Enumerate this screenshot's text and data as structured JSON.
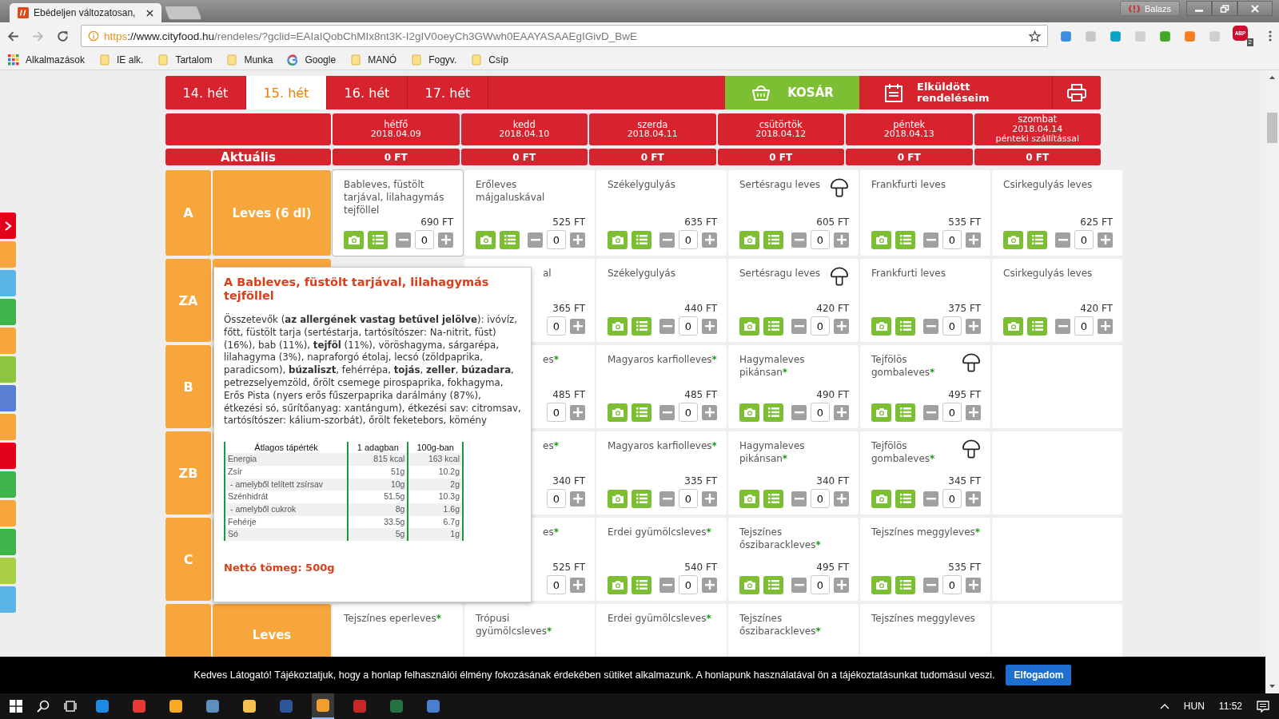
{
  "browser": {
    "tab_title": "Ebédeljen változatosan,",
    "profile": "Balazs",
    "url": {
      "scheme": "https",
      "authority": "://www.cityfood.hu",
      "path": "/rendeles/?gclid=EAIaIQobChMIx8nt3K-I2gIV0oeyCh3GWwh0EAAYASAAEgIGivD_BwE"
    },
    "adblock_label": "ABP",
    "adblock_badge": "2",
    "bookmarks": [
      {
        "label": "Alkalmazások",
        "kind": "apps"
      },
      {
        "label": "IE alk.",
        "kind": "folder"
      },
      {
        "label": "Tartalom",
        "kind": "folder"
      },
      {
        "label": "Munka",
        "kind": "folder"
      },
      {
        "label": "Google",
        "kind": "google"
      },
      {
        "label": "MANÓ",
        "kind": "folder"
      },
      {
        "label": "Fogyv.",
        "kind": "folder"
      },
      {
        "label": "Csíp",
        "kind": "folder"
      }
    ]
  },
  "side_tabs": [
    {
      "color": "#f7a63c"
    },
    {
      "color": "#5ab4e5"
    },
    {
      "color": "#3db54a"
    },
    {
      "color": "#f7a63c"
    },
    {
      "color": "#8cc63f"
    },
    {
      "color": "#5b7fd0"
    },
    {
      "color": "#f7a63c"
    },
    {
      "color": "#e3001b"
    },
    {
      "color": "#3db54a"
    },
    {
      "color": "#f7a63c"
    },
    {
      "color": "#3db54a"
    },
    {
      "color": "#a8cf45"
    },
    {
      "color": "#5ab4e5"
    }
  ],
  "weeks": [
    {
      "label": "14. hét",
      "selected": false
    },
    {
      "label": "15. hét",
      "selected": true
    },
    {
      "label": "16. hét",
      "selected": false
    },
    {
      "label": "17. hét",
      "selected": false
    }
  ],
  "cart": "KOSÁR",
  "sent_orders": "Elküldött rendeléseim",
  "days": [
    {
      "name": "hétfő",
      "date": "2018.04.09"
    },
    {
      "name": "kedd",
      "date": "2018.04.10"
    },
    {
      "name": "szerda",
      "date": "2018.04.11"
    },
    {
      "name": "csütörtök",
      "date": "2018.04.12"
    },
    {
      "name": "péntek",
      "date": "2018.04.13"
    },
    {
      "name": "szombat",
      "date": "2018.04.14",
      "note": "pénteki szállítással"
    }
  ],
  "current": {
    "label": "Aktuális",
    "totals": [
      "0 FT",
      "0 FT",
      "0 FT",
      "0 FT",
      "0 FT",
      "0 FT"
    ]
  },
  "rows": [
    {
      "code": "A",
      "category": "Leves (6 dl)",
      "cells": [
        {
          "kind": "dish",
          "name": "Bableves, füstölt tarjával, lilahagymás tejföllel",
          "mushroom": false,
          "price": "690 FT",
          "quantity": "0"
        },
        {
          "kind": "dish",
          "name": "Erőleves májgaluskával",
          "mushroom": false,
          "price": "525 FT",
          "quantity": "0"
        },
        {
          "kind": "dish",
          "name": "Székelygulyás",
          "mushroom": false,
          "price": "635 FT",
          "quantity": "0"
        },
        {
          "kind": "dish",
          "name": "Sertésragu leves",
          "mushroom": true,
          "price": "605 FT",
          "quantity": "0"
        },
        {
          "kind": "dish",
          "name": "Frankfurti leves",
          "mushroom": false,
          "price": "535 FT",
          "quantity": "0"
        },
        {
          "kind": "dish",
          "name": "Csirkegulyás leves",
          "mushroom": false,
          "price": "625 FT",
          "quantity": "0"
        }
      ]
    },
    {
      "code": "ZA",
      "cells": [
        {
          "kind": "hidden"
        },
        {
          "kind": "partial",
          "name": "al",
          "price": "365 FT",
          "quantity": "0"
        },
        {
          "kind": "dish",
          "name": "Székelygulyás",
          "mushroom": false,
          "price": "440 FT",
          "quantity": "0"
        },
        {
          "kind": "dish",
          "name": "Sertésragu leves",
          "mushroom": true,
          "price": "420 FT",
          "quantity": "0"
        },
        {
          "kind": "dish",
          "name": "Frankfurti leves",
          "mushroom": false,
          "price": "375 FT",
          "quantity": "0"
        },
        {
          "kind": "dish",
          "name": "Csirkegulyás leves",
          "mushroom": false,
          "price": "420 FT",
          "quantity": "0"
        }
      ]
    },
    {
      "code": "B",
      "cells": [
        {
          "kind": "hidden"
        },
        {
          "kind": "partial",
          "name": "es",
          "mark": "*",
          "price": "485 FT",
          "quantity": "0"
        },
        {
          "kind": "dish",
          "name": "Magyaros karfiolleves",
          "mark": "*",
          "mushroom": false,
          "price": "485 FT",
          "quantity": "0"
        },
        {
          "kind": "dish",
          "name": "Hagymaleves pikánsan",
          "mark": "*",
          "mushroom": false,
          "price": "490 FT",
          "quantity": "0"
        },
        {
          "kind": "dish",
          "name": "Tejfölös gombaleves",
          "mark": "*",
          "mushroom": true,
          "price": "495 FT",
          "quantity": "0"
        },
        {
          "kind": "empty"
        }
      ]
    },
    {
      "code": "ZB",
      "cells": [
        {
          "kind": "hidden"
        },
        {
          "kind": "partial",
          "name": "es",
          "mark": "*",
          "price": "340 FT",
          "quantity": "0"
        },
        {
          "kind": "dish",
          "name": "Magyaros karfiolleves",
          "mark": "*",
          "mushroom": false,
          "price": "335 FT",
          "quantity": "0"
        },
        {
          "kind": "dish",
          "name": "Hagymaleves pikánsan",
          "mark": "*",
          "mushroom": false,
          "price": "340 FT",
          "quantity": "0"
        },
        {
          "kind": "dish",
          "name": "Tejfölös gombaleves",
          "mark": "*",
          "mushroom": true,
          "price": "345 FT",
          "quantity": "0"
        },
        {
          "kind": "empty"
        }
      ]
    },
    {
      "code": "C",
      "cells": [
        {
          "kind": "hidden"
        },
        {
          "kind": "partial",
          "name": "es",
          "mark": "*",
          "price": "525 FT",
          "quantity": "0"
        },
        {
          "kind": "dish",
          "name": "Erdei gyümölcsleves",
          "mark": "*",
          "mushroom": false,
          "price": "540 FT",
          "quantity": "0"
        },
        {
          "kind": "dish",
          "name": "Tejszínes őszibarackleves",
          "mark": "*",
          "mushroom": false,
          "price": "495 FT",
          "quantity": "0"
        },
        {
          "kind": "dish",
          "name": "Tejszínes meggyleves",
          "mark": "*",
          "mushroom": false,
          "price": "535 FT",
          "quantity": "0"
        },
        {
          "kind": "empty"
        }
      ]
    },
    {
      "category": "Leves",
      "cells": [
        {
          "kind": "cut",
          "name": "Tejszínes eperleves",
          "mark": "*"
        },
        {
          "kind": "cut",
          "name": "Trópusi gyümölcsleves",
          "mark": "*"
        },
        {
          "kind": "cut",
          "name": "Erdei gyümölcsleves",
          "mark": "*"
        },
        {
          "kind": "cut",
          "name": "Tejszínes őszibarackleves",
          "mark": "*"
        },
        {
          "kind": "cut",
          "name": "Tejszínes meggyleves"
        },
        {
          "kind": "empty"
        }
      ]
    }
  ],
  "tooltip": {
    "title": "A Bableves, füstölt tarjával, lilahagymás tejföllel",
    "ingredients": "Összetevők (**az allergének vastag betűvel jelölve**): ivóvíz, főtt, füstölt tarja (sertéstarja, tartósítószer: Na-nitrit, füst) (16%), bab (11%), **tejföl** (11%), vöröshagyma, sárgarépa, lilahagyma (3%), napraforgó étolaj, lecsó (zöldpaprika, paradicsom), **búzaliszt**, fehérrépa, **tojás**, **zeller**, **búzadara**, petrezselyemzöld, őrölt csemege pirospaprika, fokhagyma, Erős Pista (nyers erős fűszerpaprika darálmány (87%), étkezési só, sűrítőanyag: xantángum), étkezési sav: citromsav, tartósítószer: kálium-szorbát), őrölt feketebors, kömény",
    "nutrition": {
      "columns": [
        "Átlagos tápérték",
        "1 adagban",
        "100g-ban"
      ],
      "rows": [
        {
          "label": "Energia",
          "sub": false,
          "per_portion": "815 kcal",
          "per_100g": "163 kcal"
        },
        {
          "label": "Zsír",
          "sub": false,
          "per_portion": "51g",
          "per_100g": "10.2g"
        },
        {
          "label": "- amelyből telített zsírsav",
          "sub": true,
          "per_portion": "10g",
          "per_100g": "2g"
        },
        {
          "label": "Szénhidrát",
          "sub": false,
          "per_portion": "51.5g",
          "per_100g": "10.3g"
        },
        {
          "label": "- amelyből cukrok",
          "sub": true,
          "per_portion": "8g",
          "per_100g": "1.6g"
        },
        {
          "label": "Fehérje",
          "sub": false,
          "per_portion": "33.5g",
          "per_100g": "6.7g"
        },
        {
          "label": "Só",
          "sub": false,
          "per_portion": "5g",
          "per_100g": "1g"
        }
      ]
    },
    "net_weight": "Nettó tömeg: 500g"
  },
  "cookie": {
    "text": "Kedves Látogató! Tájékoztatjuk, hogy a honlap felhasználói élmény fokozásának érdekében sütiket alkalmazunk. A honlapunk használatával ön a tájékoztatásunkat tudomásul veszi.",
    "button": "Elfogadom"
  },
  "taskbar": {
    "language": "HUN",
    "time": "11:52"
  }
}
